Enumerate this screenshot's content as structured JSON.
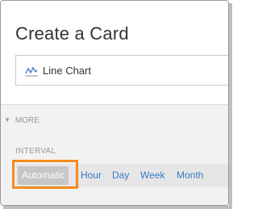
{
  "card": {
    "title": "Create a Card",
    "type_picker": {
      "label": "Line Chart",
      "icon": "line-chart-icon"
    }
  },
  "more": {
    "toggle_label": "MORE",
    "interval": {
      "label": "INTERVAL",
      "options": [
        "Automatic",
        "Hour",
        "Day",
        "Week",
        "Month"
      ],
      "selected": "Automatic"
    }
  },
  "colors": {
    "link": "#3a79c4",
    "selected_bg": "#c6c6c6",
    "highlight": "#f28c1e",
    "section_bg": "#f2f2f2"
  }
}
